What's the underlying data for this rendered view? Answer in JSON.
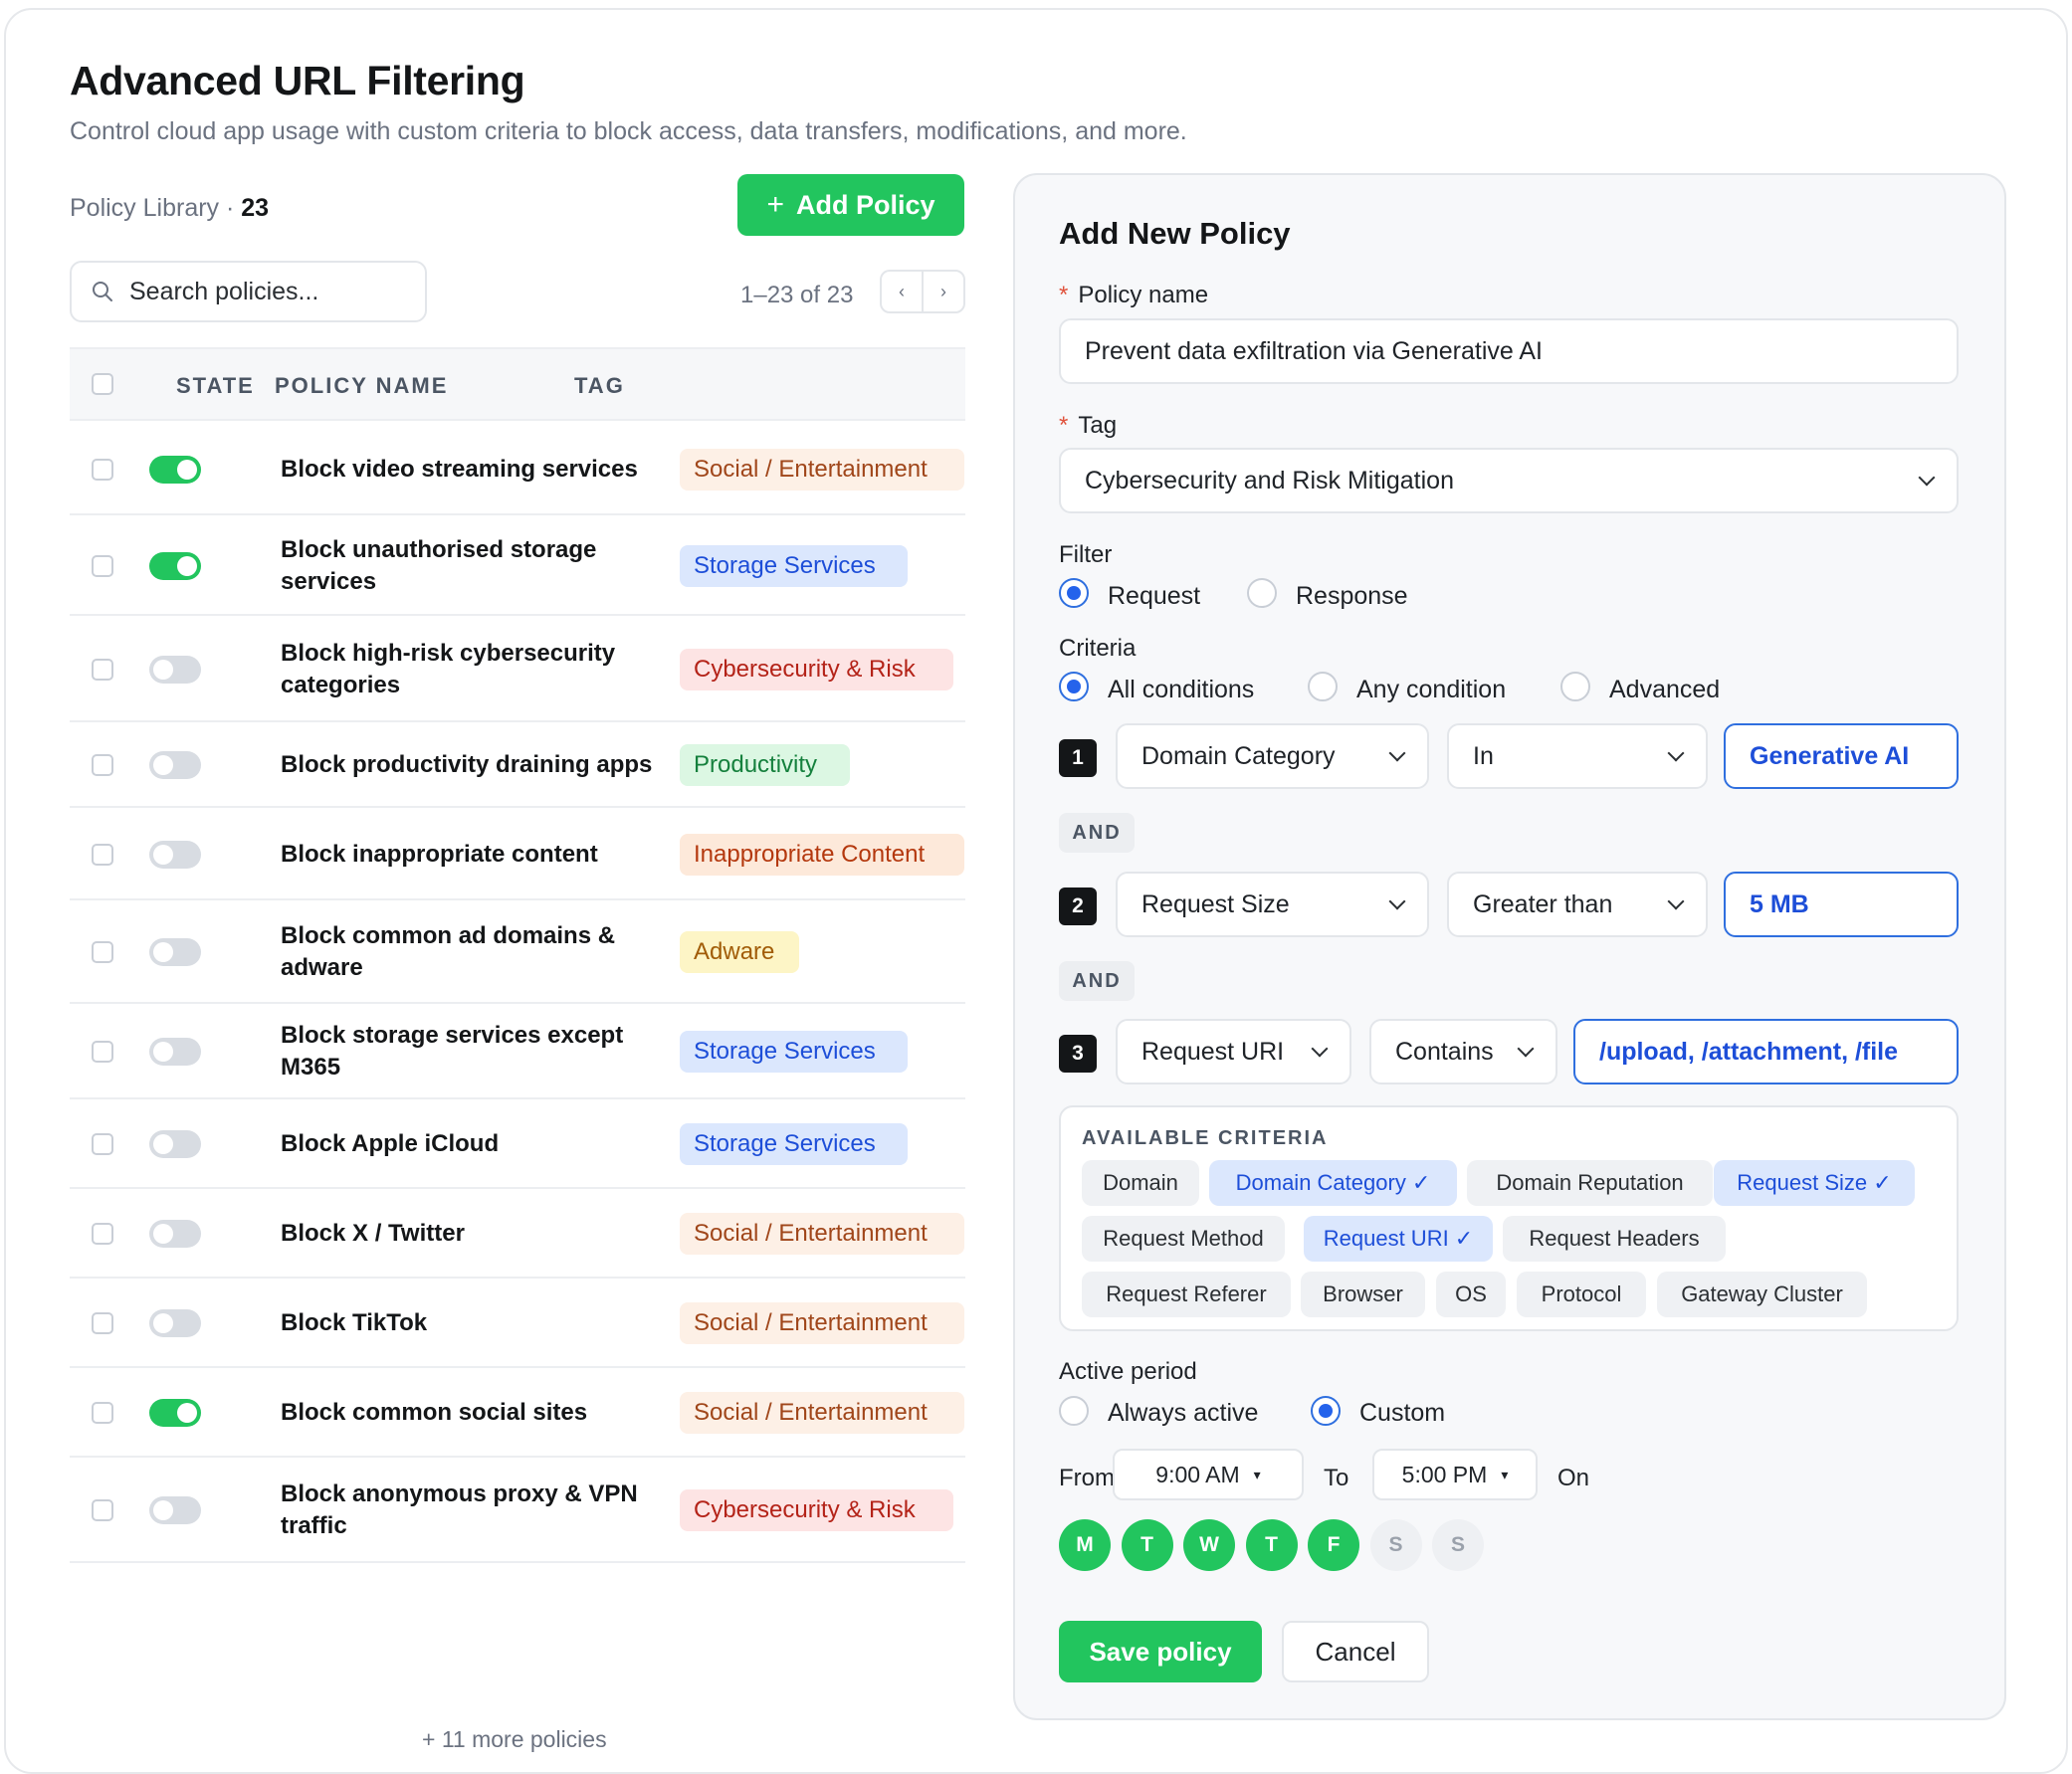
{
  "page": {
    "title": "Advanced URL Filtering",
    "subtitle": "Control cloud app usage with custom criteria to block access, data transfers, modifications, and more."
  },
  "library": {
    "label": "Policy Library",
    "count": "23",
    "add_button": "Add Policy",
    "search_placeholder": "Search policies...",
    "pager": "1–23 of 23",
    "prev": "‹",
    "next": "›",
    "columns": {
      "state": "STATE",
      "name": "POLICY NAME",
      "tag": "TAG"
    },
    "policies": [
      {
        "name": "Block video streaming services",
        "enabled": true,
        "tag": "Social / Entertainment",
        "tag_style": "social"
      },
      {
        "name": "Block unauthorised storage services",
        "enabled": true,
        "tag": "Storage Services",
        "tag_style": "storage"
      },
      {
        "name": "Block high-risk cybersecurity categories",
        "enabled": false,
        "tag": "Cybersecurity & Risk",
        "tag_style": "cyber"
      },
      {
        "name": "Block productivity draining apps",
        "enabled": false,
        "tag": "Productivity",
        "tag_style": "productivity"
      },
      {
        "name": "Block inappropriate content",
        "enabled": false,
        "tag": "Inappropriate Content",
        "tag_style": "inappropriate"
      },
      {
        "name": "Block common ad domains & adware",
        "enabled": false,
        "tag": "Adware",
        "tag_style": "adware"
      },
      {
        "name": "Block storage services except M365",
        "enabled": false,
        "tag": "Storage Services",
        "tag_style": "storage"
      },
      {
        "name": "Block Apple iCloud",
        "enabled": false,
        "tag": "Storage Services",
        "tag_style": "storage"
      },
      {
        "name": "Block X / Twitter",
        "enabled": false,
        "tag": "Social / Entertainment",
        "tag_style": "social"
      },
      {
        "name": "Block TikTok",
        "enabled": false,
        "tag": "Social / Entertainment",
        "tag_style": "social"
      },
      {
        "name": "Block common social sites",
        "enabled": true,
        "tag": "Social / Entertainment",
        "tag_style": "social"
      },
      {
        "name": "Block anonymous proxy & VPN traffic",
        "enabled": false,
        "tag": "Cybersecurity & Risk",
        "tag_style": "cyber"
      }
    ],
    "more": "+ 11 more policies"
  },
  "tag_styles": {
    "social": {
      "bg": "#fdf0e6",
      "fg": "#a0461a"
    },
    "storage": {
      "bg": "#dbe7fd",
      "fg": "#1d4ed8"
    },
    "cyber": {
      "bg": "#fde4e4",
      "fg": "#b42318"
    },
    "productivity": {
      "bg": "#dcf7e3",
      "fg": "#15803d"
    },
    "inappropriate": {
      "bg": "#fde9da",
      "fg": "#b4380e"
    },
    "adware": {
      "bg": "#fdf5c6",
      "fg": "#a15c07"
    }
  },
  "form": {
    "title": "Add New Policy",
    "required_mark": "*",
    "policy_name_label": "Policy name",
    "policy_name_value": "Prevent data exfiltration via Generative AI",
    "tag_label": "Tag",
    "tag_value": "Cybersecurity and Risk Mitigation",
    "filter_label": "Filter",
    "filter_options": [
      "Request",
      "Response"
    ],
    "filter_selected": "Request",
    "criteria_label": "Criteria",
    "criteria_options": [
      "All conditions",
      "Any condition",
      "Advanced"
    ],
    "criteria_selected": "All conditions",
    "and_label": "AND",
    "conditions": [
      {
        "num": "1",
        "field": "Domain Category",
        "op": "In",
        "value": "Generative AI"
      },
      {
        "num": "2",
        "field": "Request Size",
        "op": "Greater than",
        "value": "5 MB"
      },
      {
        "num": "3",
        "field": "Request URI",
        "op": "Contains",
        "value": "/upload, /attachment, /file"
      }
    ],
    "available_title": "AVAILABLE CRITERIA",
    "available": [
      {
        "label": "Domain",
        "selected": false
      },
      {
        "label": "Domain Category ✓",
        "selected": true
      },
      {
        "label": "Domain Reputation",
        "selected": false
      },
      {
        "label": "Request Size ✓",
        "selected": true
      },
      {
        "label": "Request Method",
        "selected": false
      },
      {
        "label": "Request URI ✓",
        "selected": true
      },
      {
        "label": "Request Headers",
        "selected": false
      },
      {
        "label": "Request Referer",
        "selected": false
      },
      {
        "label": "Browser",
        "selected": false
      },
      {
        "label": "OS",
        "selected": false
      },
      {
        "label": "Protocol",
        "selected": false
      },
      {
        "label": "Gateway Cluster",
        "selected": false
      }
    ],
    "active_label": "Active period",
    "active_options": [
      "Always active",
      "Custom"
    ],
    "active_selected": "Custom",
    "from_label": "From",
    "from_value": "9:00 AM",
    "to_label": "To",
    "to_value": "5:00 PM",
    "on_label": "On",
    "caret": "▾",
    "days": [
      {
        "label": "M",
        "on": true
      },
      {
        "label": "T",
        "on": true
      },
      {
        "label": "W",
        "on": true
      },
      {
        "label": "T",
        "on": true
      },
      {
        "label": "F",
        "on": true
      },
      {
        "label": "S",
        "on": false
      },
      {
        "label": "S",
        "on": false
      }
    ],
    "save": "Save policy",
    "cancel": "Cancel"
  }
}
